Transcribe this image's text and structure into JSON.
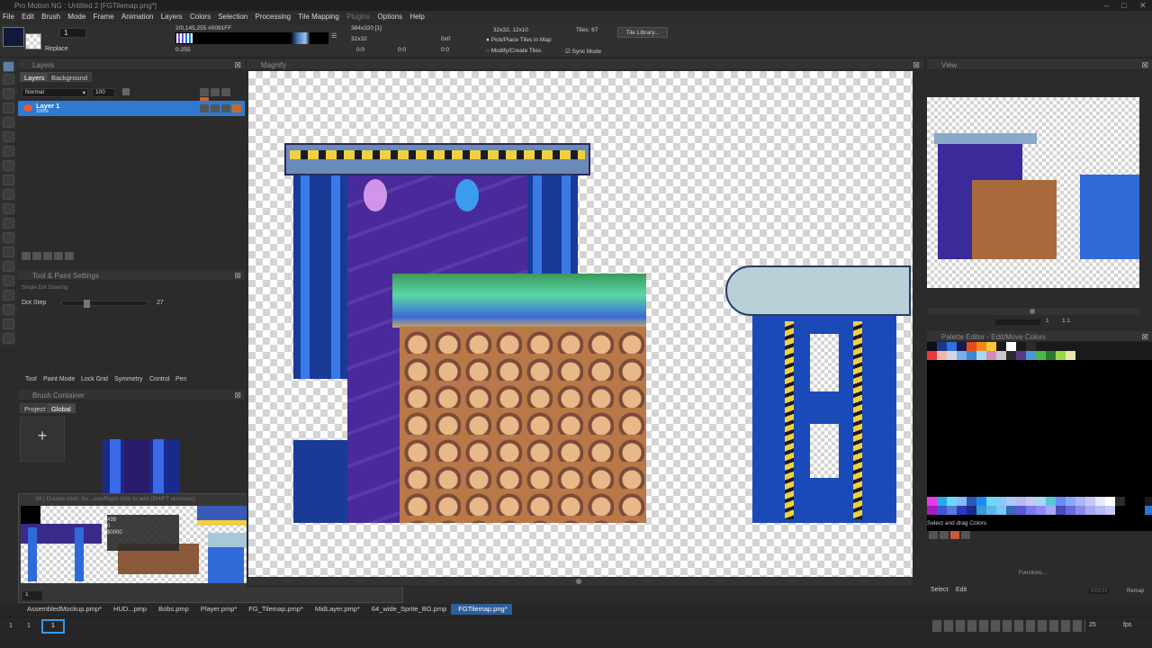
{
  "window": {
    "title": "Pro Motion NG : Untitled 2 [FGTilemap.png*]",
    "controls": [
      "–",
      "□",
      "✕"
    ]
  },
  "menu": [
    "File",
    "Edit",
    "Brush",
    "Mode",
    "Frame",
    "Animation",
    "Layers",
    "Colors",
    "Selection",
    "Processing",
    "Tile Mapping",
    "Plugins",
    "Options",
    "Help"
  ],
  "toolbar": {
    "brush_size": "1",
    "mode_label": "Replace",
    "color_info": "2/0,145,255 #0091FF",
    "range_label": "0-255",
    "image_size": "384x320 [1]",
    "cursor_size": "32x32",
    "coord_a": "0:0",
    "coord_b": "0:0",
    "coord_c": "0:0",
    "offset": "0x0",
    "tile_grid": "32x32, 12x10",
    "tiles_label": "Tiles:",
    "tiles_count": "67",
    "pick_place_label": "Pick/Place Tiles in Map",
    "modify_create_label": "Modify/Create Tiles",
    "sync_mode_label": "Sync Mode",
    "tile_library_button": "Tile Library..."
  },
  "layers_panel": {
    "title": "Layers",
    "tabs": [
      "Layers",
      "Background"
    ],
    "blend_mode": "Normal",
    "opacity": "100",
    "layer_name": "Layer 1",
    "layer_opacity": "100%"
  },
  "tool_settings": {
    "title": "Tool & Paint Settings",
    "subtitle": "Single Dot Drawing",
    "dot_step_label": "Dot Step",
    "dot_step_value": "27",
    "dot_step_fraction": 0.27,
    "tabs": [
      "Tool",
      "Paint Mode",
      "Lock Grid",
      "Symmetry",
      "Control",
      "Pen"
    ]
  },
  "brush_container": {
    "title": "Brush Container",
    "tabs": [
      "Project",
      "Global"
    ],
    "add_symbol": "+"
  },
  "tile_popup": {
    "hint": "39 | Double click: Se...ove/Right click to add (SHIFT removes)",
    "tooltip_lines": [
      "#39",
      "0",
      "$0000"
    ],
    "page": "1"
  },
  "magnify_panel": {
    "title": "Magnify"
  },
  "view_panel": {
    "title": "View",
    "zoom_a": "1",
    "zoom_b": "1:1"
  },
  "palette_panel": {
    "title": "Palette Editor - Edit/Move Colors",
    "hint": "Select and drag Colors",
    "functions_label": "Functions...",
    "select_tab": "Select",
    "edit_tab": "Edit",
    "index_readout": "0/0/133",
    "remap_label": "Remap",
    "row1": [
      "#0f0f1a",
      "#1a3a8a",
      "#2f72d8",
      "#1a1a4a",
      "#e84a1a",
      "#f08a1a",
      "#f8c83a",
      "#1a1a1a",
      "#ffffff",
      "#1a1a1a",
      "#2a2a2a",
      "#1a1a1a",
      "#1a1a1a",
      "#1a1a1a",
      "#1a1a1a",
      "#1a1a1a",
      "#1a1a1a",
      "#1a1a1a",
      "#1a1a1a",
      "#1a1a1a",
      "#1a1a1a",
      "#1a1a1a",
      "#1a1a1a"
    ],
    "row2": [
      "#e83a3a",
      "#f5b8a8",
      "#d0d8e8",
      "#7ab0e8",
      "#3a8ad8",
      "#a8d8f8",
      "#d88ab8",
      "#c8c8c8",
      "#2a2a2a",
      "#5a3a8a",
      "#4a9ad8",
      "#4ab84a",
      "#2a7a2a",
      "#9ad84a",
      "#e8e8a8",
      "#1a1a1a",
      "#1a1a1a",
      "#1a1a1a",
      "#1a1a1a",
      "#1a1a1a",
      "#1a1a1a",
      "#1a1a1a",
      "#1a1a1a"
    ],
    "row3": [
      "#e83ae8",
      "#2aa8e8",
      "#6ad8f8",
      "#8ab8f8",
      "#2a5ab8",
      "#1a8af8",
      "#6ad8f8",
      "#8ac8f8",
      "#aac8f8",
      "#b8b8f8",
      "#c8c8f8",
      "#a8d8f8",
      "#58c8d8",
      "#6a8af8",
      "#8aa8f8",
      "#a8b8f8",
      "#c8c8f8",
      "#e8e8f8",
      "#ffffff",
      "#2a2a2a",
      "#000000",
      "#000000",
      "#1a1a1a"
    ],
    "row4": [
      "#a81ab8",
      "#3a5ad8",
      "#5a7ad8",
      "#2a3ab8",
      "#1a2a88",
      "#3a9ad8",
      "#5ab8e8",
      "#7ac8f8",
      "#3a6ab8",
      "#5a5ad8",
      "#7a7ae8",
      "#8a8af8",
      "#a8a8f8",
      "#4a4ab8",
      "#6a6ad8",
      "#8a8ae8",
      "#a8a8f8",
      "#b8b8f8",
      "#c8c8f8",
      "#000000",
      "#000000",
      "#000000",
      "#2f72d8"
    ]
  },
  "document_tabs": [
    "AssembledMockup.pmp*",
    "HUD...pmp",
    "Bobs.pmp",
    "Player.pmp*",
    "FG_Tilemap.pmp*",
    "MidLayer.pmp*",
    "64_wide_Sprite_BG.pmp",
    "FGTilemap.png*"
  ],
  "active_doc_tab": 7,
  "statusbar": {
    "frame_left": "1",
    "frame_current": "1",
    "frame_total": "1",
    "fps_value": "25",
    "fps_label": "fps"
  }
}
